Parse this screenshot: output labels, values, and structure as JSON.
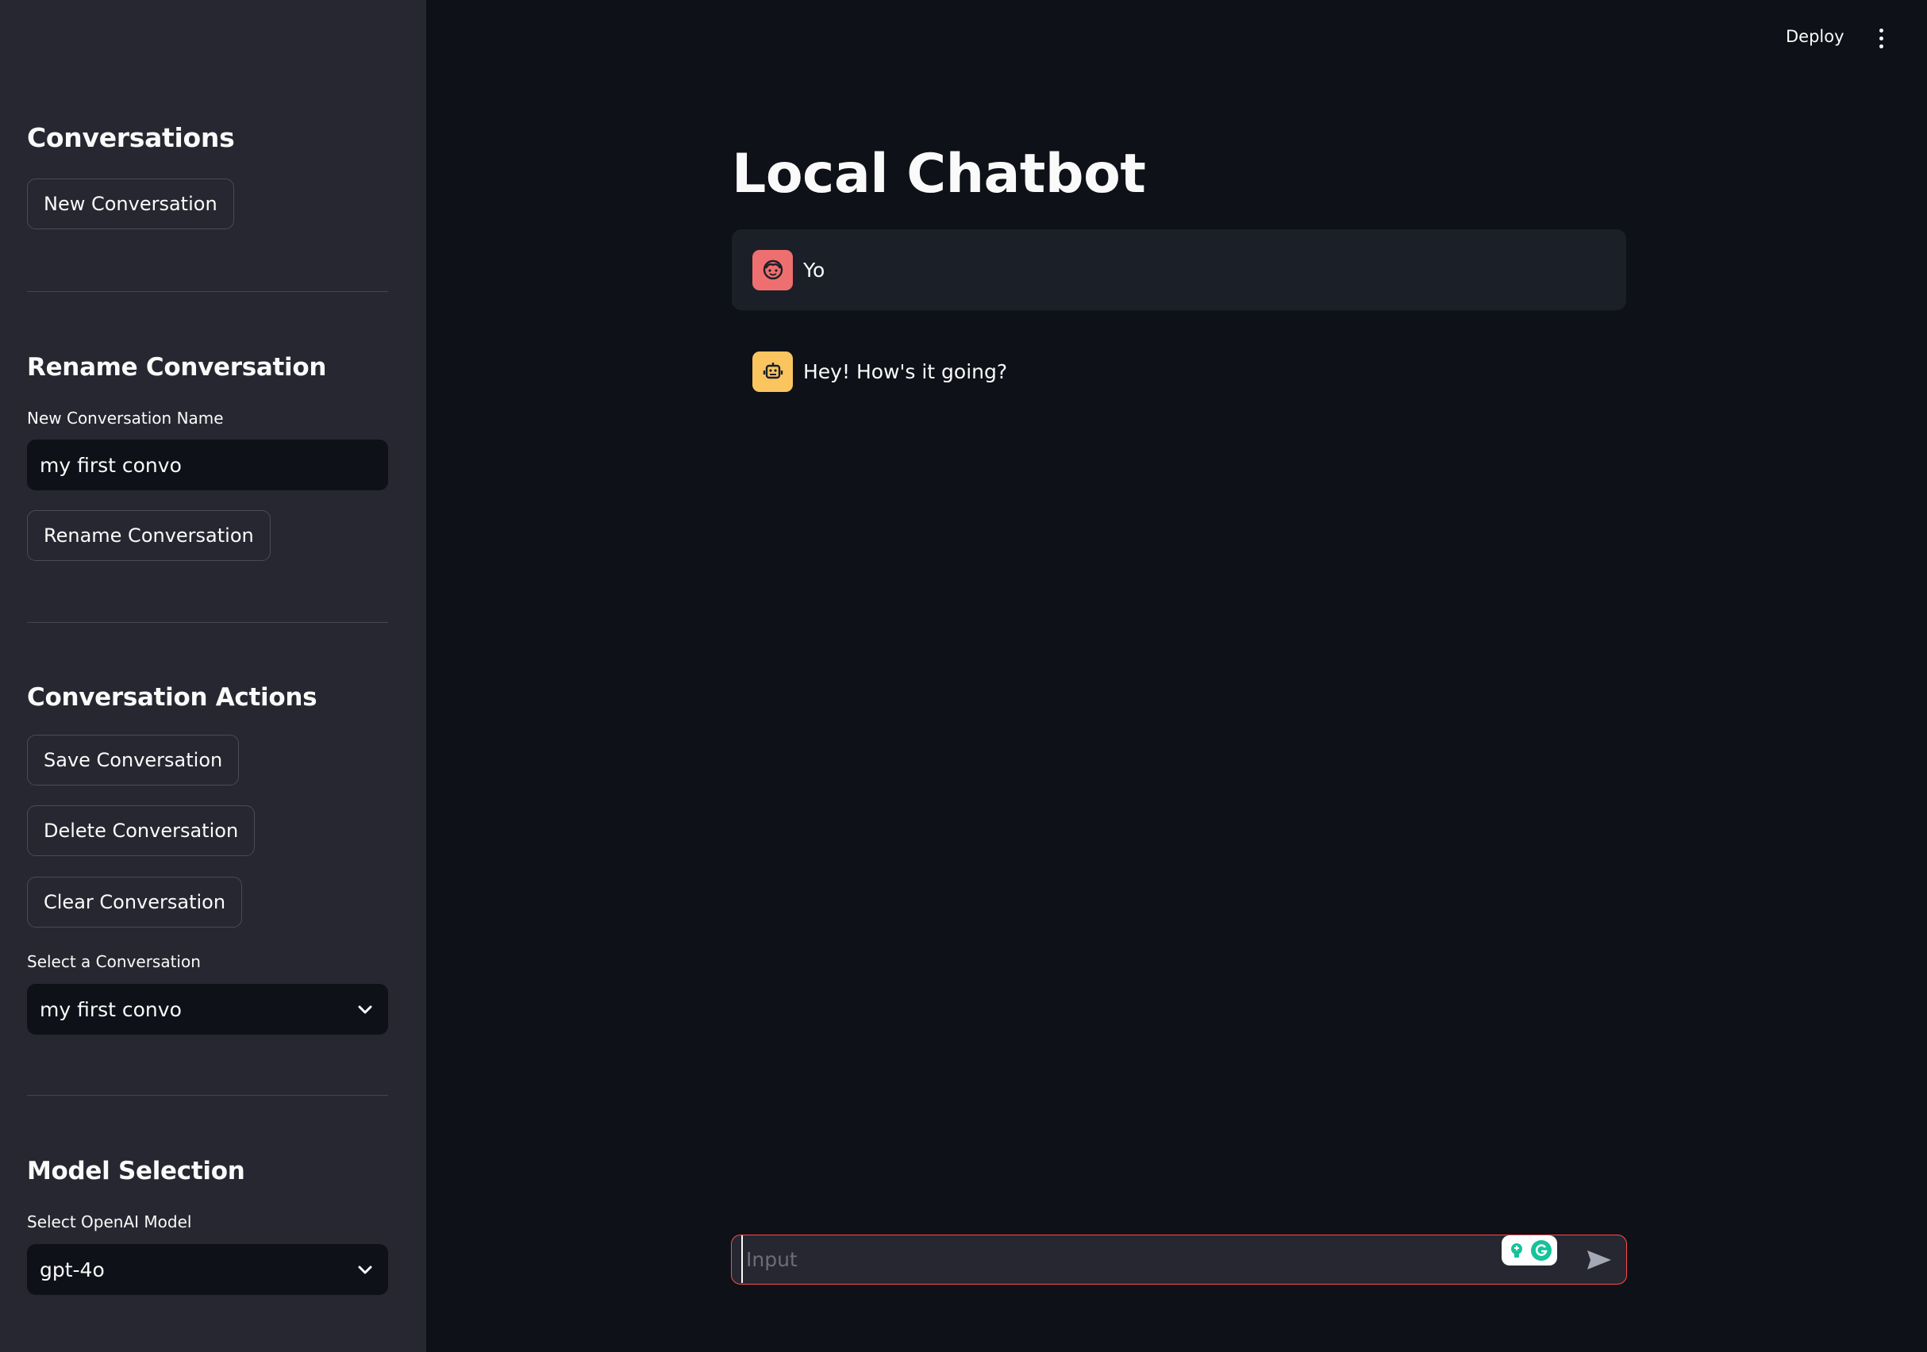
{
  "header": {
    "deploy_label": "Deploy",
    "menu_icon": "kebab-menu-icon"
  },
  "sidebar": {
    "conversations_heading": "Conversations",
    "new_conversation_label": "New Conversation",
    "rename_heading": "Rename Conversation",
    "rename_field_label": "New Conversation Name",
    "rename_field_value": "my first convo",
    "rename_button_label": "Rename Conversation",
    "actions_heading": "Conversation Actions",
    "save_label": "Save Conversation",
    "delete_label": "Delete Conversation",
    "clear_label": "Clear Conversation",
    "select_conversation_label": "Select a Conversation",
    "select_conversation_value": "my first convo",
    "model_heading": "Model Selection",
    "select_model_label": "Select OpenAI Model",
    "select_model_value": "gpt-4o"
  },
  "main": {
    "title": "Local Chatbot",
    "messages": [
      {
        "role": "user",
        "avatar_icon": "user-face-icon",
        "text": "Yo"
      },
      {
        "role": "assistant",
        "avatar_icon": "robot-icon",
        "text": "Hey! How's it going?"
      }
    ],
    "chat_input": {
      "placeholder": "Input",
      "value": ""
    }
  },
  "colors": {
    "sidebar_bg": "#262730",
    "main_bg": "#0e1117",
    "user_avatar": "#ee6f6f",
    "bot_avatar": "#fac45f",
    "input_focus_border": "#ff4b4b"
  }
}
